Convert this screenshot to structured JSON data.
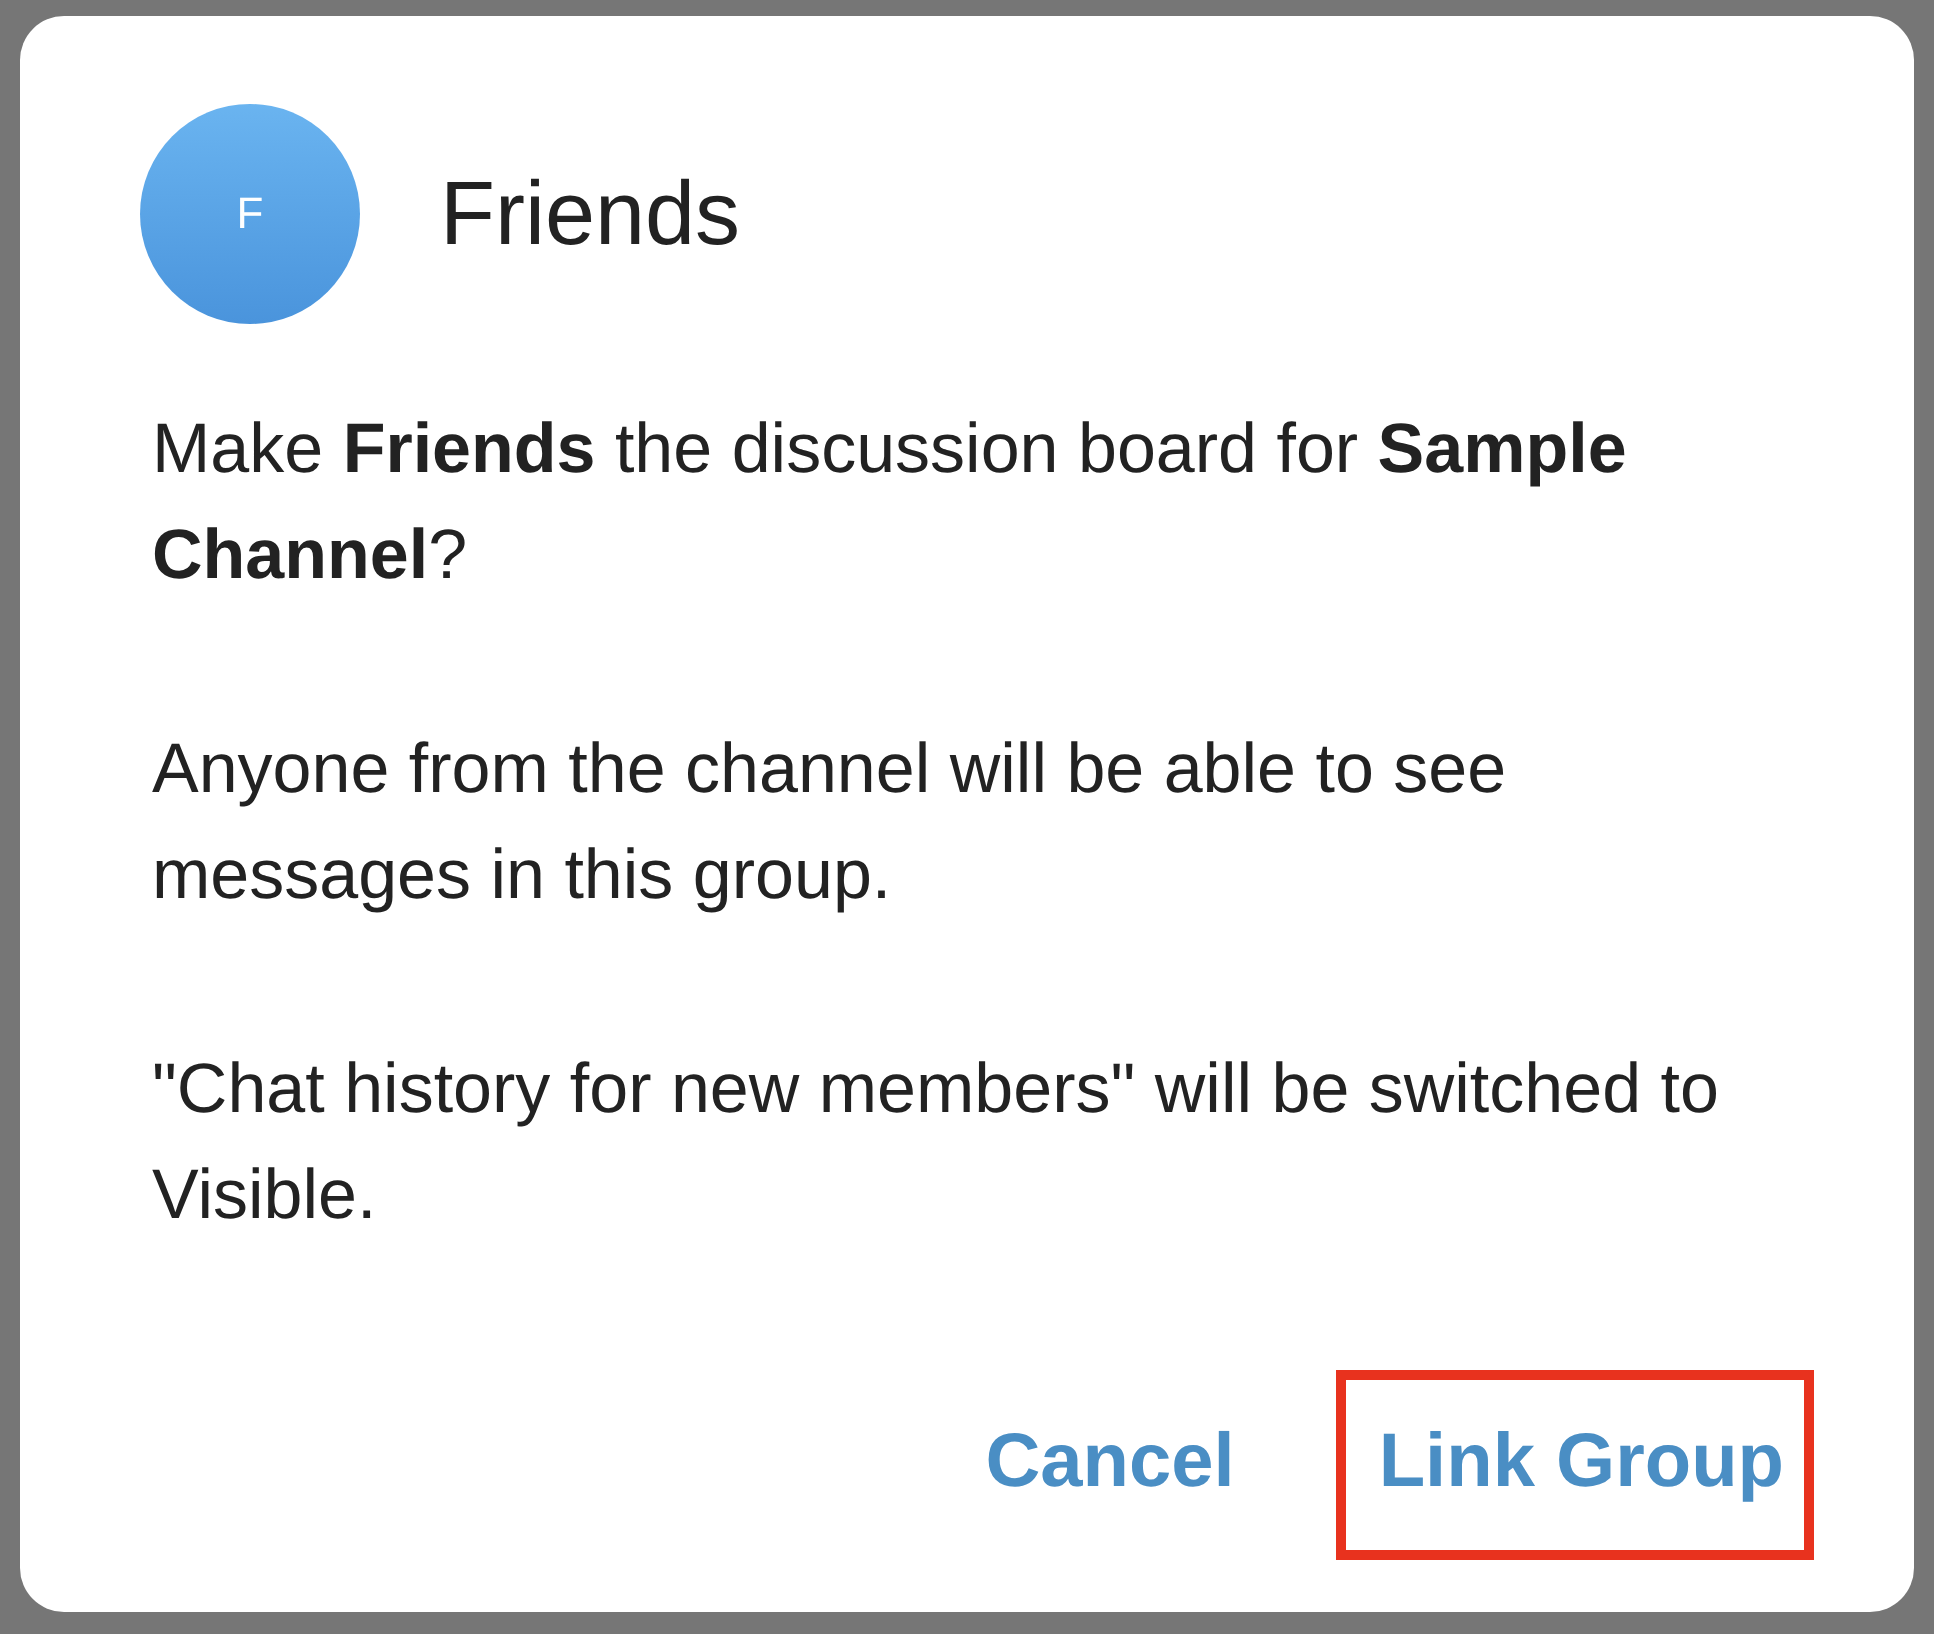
{
  "dialog": {
    "avatar": {
      "letter": "F"
    },
    "title": "Friends",
    "paragraphs": [
      "Make **Friends** the discussion board for **Sample Channel**?",
      "Anyone from the channel will be able to see messages in this group.",
      "\"Chat history for new members\" will be switched to Visible."
    ],
    "buttons": [
      {
        "label": "Cancel",
        "highlighted": false
      },
      {
        "label": "Link Group",
        "highlighted": true
      }
    ]
  }
}
